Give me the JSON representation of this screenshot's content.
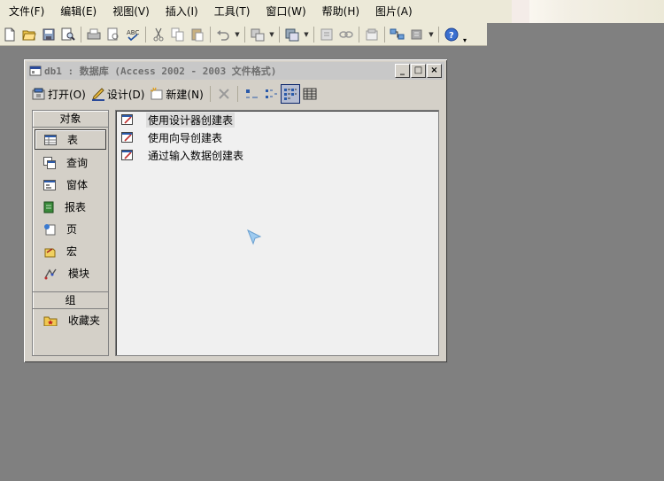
{
  "menubar": {
    "items": [
      "文件(F)",
      "编辑(E)",
      "视图(V)",
      "插入(I)",
      "工具(T)",
      "窗口(W)",
      "帮助(H)",
      "图片(A)"
    ]
  },
  "toolbar": {
    "icons": [
      "new-icon",
      "open-icon",
      "save-icon",
      "file-search-icon",
      "print-icon",
      "print-preview-icon",
      "spelling-icon",
      "cut-icon",
      "copy-icon",
      "paste-icon",
      "undo-icon",
      "office-links-icon",
      "analyze-icon",
      "code-icon",
      "properties-icon",
      "relationships-icon",
      "new-object-icon",
      "help-icon"
    ]
  },
  "db_window": {
    "title": "db1 : 数据库 (Access 2002 - 2003 文件格式)",
    "toolbar": {
      "open_label": "打开(O)",
      "design_label": "设计(D)",
      "new_label": "新建(N)"
    },
    "objects_header": "对象",
    "objects": [
      "表",
      "查询",
      "窗体",
      "报表",
      "页",
      "宏",
      "模块"
    ],
    "groups_header": "组",
    "groups": [
      "收藏夹"
    ],
    "list_items": [
      "使用设计器创建表",
      "使用向导创建表",
      "通过输入数据创建表"
    ]
  }
}
